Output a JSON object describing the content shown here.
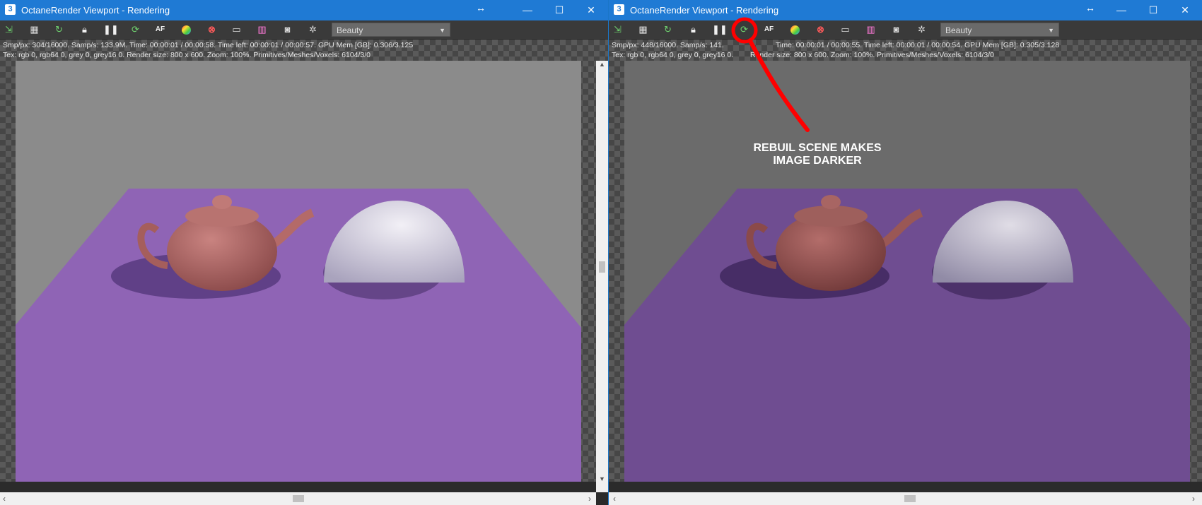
{
  "left": {
    "title": "OctaneRender Viewport - Rendering",
    "app_icon": "3",
    "render_pass": "Beauty",
    "stats_line1": "Smp/px: 304/16000.   Samp/s: 133.9M.   Time: 00:00:01 / 00:00:58.   Time left: 00:00:01 / 00:00:57.   GPU Mem [GB]: 0.306/3.125",
    "stats_line2": "Tex: rgb 0, rgb64 0, grey 0, grey16 0.   Render size: 800 x 600.   Zoom: 100%.   Primitives/Meshes/Voxels: 6104/3/0",
    "floor_color": "#8f64b5",
    "bg_color": "#8b8b8b"
  },
  "right": {
    "title": "OctaneRender Viewport - Rendering",
    "app_icon": "3",
    "render_pass": "Beauty",
    "stats_line1": "Smp/px: 448/16000.   Samp/s: 141.",
    "stats_line1b": "Time: 00:00:01 / 00:00:55.   Time left: 00:00:01 / 00:00:54.   GPU Mem [GB]: 0.305/3.128",
    "stats_line2a": "Tex: rgb 0, rgb64 0, grey 0, grey16 0.",
    "stats_line2b": "Render size: 800 x 600.   Zoom: 100%.   Primitives/Meshes/Voxels: 6104/3/0",
    "annotation_line1": "REBUIL SCENE MAKES",
    "annotation_line2": "IMAGE DARKER",
    "annotation_color": "#ff0000",
    "floor_color": "#6f4d91",
    "bg_color": "#6b6b6b"
  },
  "window_controls": {
    "resize": "↔",
    "minimize": "—",
    "maximize": "☐",
    "close": "✕"
  },
  "toolbar_icons": [
    "export-icon",
    "save-icon",
    "restart-icon",
    "lock-icon",
    "pause-icon",
    "rebuild-scene-icon",
    "af-icon",
    "color-picker-icon",
    "clay-mode-icon",
    "viewport-icon",
    "film-icon",
    "camera-icon",
    "settings-icon"
  ],
  "accent_color": "#1f7ad4"
}
